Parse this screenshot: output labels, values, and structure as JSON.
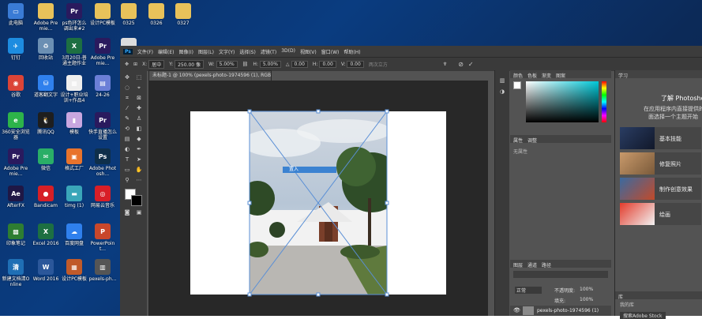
{
  "desktop": {
    "icons": [
      {
        "label": "此电脑",
        "glyph": "▭",
        "color": "#3a7bd5"
      },
      {
        "label": "Adobe Premie...",
        "glyph": "",
        "color": "#e8c25a",
        "kind": "folder"
      },
      {
        "label": "ps色环怎么调出来#2",
        "glyph": "Pr",
        "color": "#2a1a5e"
      },
      {
        "label": "设计PC模板",
        "glyph": "",
        "color": "#e8c25a",
        "kind": "folder"
      },
      {
        "label": "0325",
        "glyph": "",
        "color": "#e8c25a",
        "kind": "folder"
      },
      {
        "label": "0326",
        "glyph": "",
        "color": "#e8c25a",
        "kind": "folder"
      },
      {
        "label": "0327",
        "glyph": "",
        "color": "#e8c25a",
        "kind": "folder"
      },
      {
        "label": "钉钉",
        "glyph": "✈",
        "color": "#1d8ce0"
      },
      {
        "label": "回收站",
        "glyph": "♻",
        "color": "#6b8fb3"
      },
      {
        "label": "3月20日-普通主题作业",
        "glyph": "X",
        "color": "#1d6f42"
      },
      {
        "label": "Adobe Premie...",
        "glyph": "Pr",
        "color": "#2a1a5e"
      },
      {
        "label": "pe...",
        "glyph": "",
        "color": "#ddd",
        "kind": "doc"
      },
      {
        "label": "谷歌",
        "glyph": "◉",
        "color": "#db4437"
      },
      {
        "label": "道客翻文字",
        "glyph": "⛁",
        "color": "#2f80ed"
      },
      {
        "label": "设计+职业培训+作品4",
        "glyph": "▦",
        "color": "#eee",
        "kind": "doc"
      },
      {
        "label": "24-26",
        "glyph": "▤",
        "color": "#6b7fd7"
      },
      {
        "label": "360安全浏览器",
        "glyph": "e",
        "color": "#2db34a"
      },
      {
        "label": "腾讯QQ",
        "glyph": "🐧",
        "color": "#1e1e1e"
      },
      {
        "label": "模板",
        "glyph": "▮",
        "color": "#c9a7e0"
      },
      {
        "label": "快手直播怎么设置",
        "glyph": "Pr",
        "color": "#2a1a5e"
      },
      {
        "label": "Adobe Premie...",
        "glyph": "Pr",
        "color": "#2a1a5e"
      },
      {
        "label": "微信",
        "glyph": "✉",
        "color": "#2aae67"
      },
      {
        "label": "格式工厂",
        "glyph": "▣",
        "color": "#e8732c"
      },
      {
        "label": "Adobe Photosh...",
        "glyph": "Ps",
        "color": "#0f2f4a"
      },
      {
        "label": "AfterFX",
        "glyph": "Ae",
        "color": "#1f1745"
      },
      {
        "label": "Bandicam",
        "glyph": "●",
        "color": "#d61f26"
      },
      {
        "label": "timg (1)",
        "glyph": "▬",
        "color": "#3aa6b9"
      },
      {
        "label": "网易云音乐",
        "glyph": "◎",
        "color": "#d81e27"
      },
      {
        "label": "印象笔记",
        "glyph": "▩",
        "color": "#2e7d32"
      },
      {
        "label": "Excel 2016",
        "glyph": "X",
        "color": "#1d6f42"
      },
      {
        "label": "百度网盘",
        "glyph": "☁",
        "color": "#2f80ed"
      },
      {
        "label": "PowerPoint...",
        "glyph": "P",
        "color": "#c8472b"
      },
      {
        "label": "新建文档清Online",
        "glyph": "清",
        "color": "#1f6fb5"
      },
      {
        "label": "Word 2016",
        "glyph": "W",
        "color": "#2b579a"
      },
      {
        "label": "设计PC模板",
        "glyph": "▦",
        "color": "#c05a2a"
      },
      {
        "label": "pexels-ph...",
        "glyph": "▥",
        "color": "#555"
      }
    ]
  },
  "photoshop": {
    "menu": [
      "文件(F)",
      "编辑(E)",
      "图像(I)",
      "图层(L)",
      "文字(Y)",
      "选择(S)",
      "滤镜(T)",
      "3D(D)",
      "视图(V)",
      "窗口(W)",
      "帮助(H)"
    ],
    "options": {
      "x_label": "X:",
      "x_value": "居中",
      "y_label": "Y:",
      "y_value": "250.00 像",
      "w_label": "W:",
      "w_value": "5.00%",
      "h_label": "H:",
      "h_value": "5.00%",
      "angle_value": "0.00",
      "h2_label": "H:",
      "h2_value": "0.00",
      "v_label": "V:",
      "v_value": "0.00",
      "interp": "两次立方",
      "cancel_symbol": "⊘",
      "commit_symbol": "✓"
    },
    "doc_tab": "未标题-1 @ 100% (pexels-photo-1974596 (1), RGB/8)",
    "transform_hint": "置入",
    "panels": {
      "color_tabs": [
        "颜色",
        "色板",
        "渐变",
        "图案"
      ],
      "adjust_tabs": [
        "属性",
        "调整"
      ],
      "no_properties": "无属性",
      "layer_tabs": [
        "图层",
        "通道",
        "路径"
      ],
      "blend_mode": "正常",
      "opacity_label": "不透明度:",
      "opacity_value": "100%",
      "fill_label": "填充:",
      "fill_value": "100%",
      "layer_name": "pexels-photo-1974596 (1)"
    },
    "learn": {
      "tab": "学习",
      "title": "了解 Photoshop",
      "subtitle_1": "在应用程序内直接提供的分步",
      "subtitle_2": "面选择一个主题开始",
      "cards": [
        "基本技能",
        "修复照片",
        "制作创意效果",
        "绘画"
      ],
      "library_tab": "库",
      "library_label": "我的库",
      "library_select": "搜索Adobe Stock"
    }
  }
}
